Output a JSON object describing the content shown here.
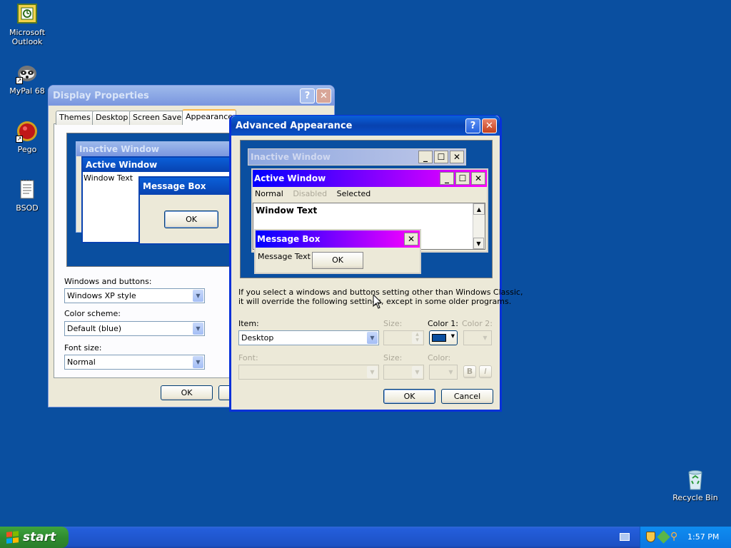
{
  "desktop": {
    "icons": [
      {
        "label": "Microsoft Outlook"
      },
      {
        "label": "MyPal 68"
      },
      {
        "label": "Pego"
      },
      {
        "label": "BSOD"
      },
      {
        "label": "Recycle Bin"
      }
    ]
  },
  "display_properties": {
    "title": "Display Properties",
    "tabs": [
      "Themes",
      "Desktop",
      "Screen Saver",
      "Appearance"
    ],
    "preview": {
      "inactive_title": "Inactive Window",
      "active_title": "Active Window",
      "window_text": "Window Text",
      "msgbox_title": "Message Box",
      "ok": "OK"
    },
    "windows_buttons_label": "Windows and buttons:",
    "windows_buttons_value": "Windows XP style",
    "color_scheme_label": "Color scheme:",
    "color_scheme_value": "Default (blue)",
    "font_size_label": "Font size:",
    "font_size_value": "Normal",
    "ok": "OK"
  },
  "advanced": {
    "title": "Advanced Appearance",
    "preview": {
      "inactive_title": "Inactive Window",
      "active_title": "Active Window",
      "menu_normal": "Normal",
      "menu_disabled": "Disabled",
      "menu_selected": "Selected",
      "window_text": "Window Text",
      "msgbox_title": "Message Box",
      "message_text": "Message Text",
      "ok": "OK"
    },
    "info_line1": "If you select a windows and buttons setting other than Windows Classic,",
    "info_line2": "it will override the following settings, except in some older programs.",
    "item_label": "Item:",
    "item_value": "Desktop",
    "size_label": "Size:",
    "color1_label": "Color 1:",
    "color2_label": "Color 2:",
    "font_label": "Font:",
    "size2_label": "Size:",
    "color_label": "Color:",
    "bold": "B",
    "italic": "I",
    "ok": "OK",
    "cancel": "Cancel"
  },
  "taskbar": {
    "start": "start",
    "clock": "1:57 PM"
  },
  "colors": {
    "desktop": "#0a4fa0",
    "active_gradient_start": "#0000ff",
    "active_gradient_end": "#ff00ff"
  }
}
